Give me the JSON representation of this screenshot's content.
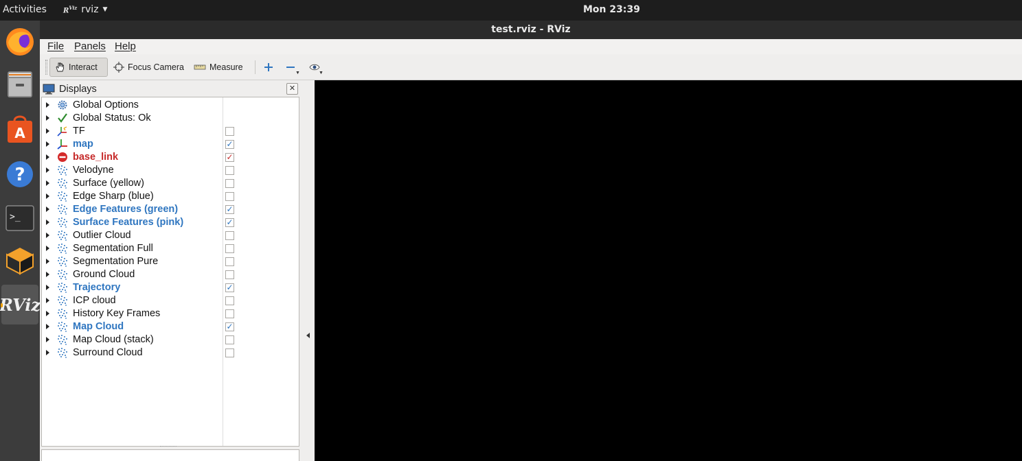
{
  "topbar": {
    "activities": "Activities",
    "app_name": "rviz",
    "app_glyph": "RViz",
    "clock": "Mon 23:39"
  },
  "dock": {
    "items": [
      {
        "name": "firefox-icon"
      },
      {
        "name": "files-icon"
      },
      {
        "name": "software-center-icon"
      },
      {
        "name": "help-icon"
      },
      {
        "name": "terminal-icon"
      },
      {
        "name": "box-icon"
      },
      {
        "name": "rviz-icon",
        "label": "RViz",
        "active": true
      }
    ]
  },
  "window": {
    "title": "test.rviz - RViz"
  },
  "menu": {
    "file": "File",
    "panels": "Panels",
    "help": "Help"
  },
  "toolbar": {
    "interact": "Interact",
    "focus_camera": "Focus Camera",
    "measure": "Measure"
  },
  "displays": {
    "title": "Displays",
    "close_glyph": "✕",
    "rows": [
      {
        "label": "Global Options",
        "icon": "gear-icon",
        "style": "normal",
        "checkbox": "none"
      },
      {
        "label": "Global Status: Ok",
        "icon": "checkmark-icon",
        "style": "normal",
        "checkbox": "none"
      },
      {
        "label": "TF",
        "icon": "tf-axes-icon",
        "style": "normal",
        "checkbox": "unchecked"
      },
      {
        "label": "map",
        "icon": "axes-icon",
        "style": "blue",
        "checkbox": "checked"
      },
      {
        "label": "base_link",
        "icon": "error-icon",
        "style": "red",
        "checkbox": "checked-red"
      },
      {
        "label": "Velodyne",
        "icon": "pointcloud-icon",
        "style": "normal",
        "checkbox": "unchecked"
      },
      {
        "label": "Surface (yellow)",
        "icon": "pointcloud-icon",
        "style": "normal",
        "checkbox": "unchecked"
      },
      {
        "label": "Edge Sharp (blue)",
        "icon": "pointcloud-icon",
        "style": "normal",
        "checkbox": "unchecked"
      },
      {
        "label": "Edge Features (green)",
        "icon": "pointcloud-icon",
        "style": "blue",
        "checkbox": "checked"
      },
      {
        "label": "Surface Features (pink)",
        "icon": "pointcloud-icon",
        "style": "blue",
        "checkbox": "checked"
      },
      {
        "label": "Outlier Cloud",
        "icon": "pointcloud-icon",
        "style": "normal",
        "checkbox": "unchecked"
      },
      {
        "label": "Segmentation Full",
        "icon": "pointcloud-icon",
        "style": "normal",
        "checkbox": "unchecked"
      },
      {
        "label": "Segmentation Pure",
        "icon": "pointcloud-icon",
        "style": "normal",
        "checkbox": "unchecked"
      },
      {
        "label": "Ground Cloud",
        "icon": "pointcloud-icon",
        "style": "normal",
        "checkbox": "unchecked"
      },
      {
        "label": "Trajectory",
        "icon": "pointcloud-icon",
        "style": "blue",
        "checkbox": "checked"
      },
      {
        "label": "ICP cloud",
        "icon": "pointcloud-icon",
        "style": "normal",
        "checkbox": "unchecked"
      },
      {
        "label": "History Key Frames",
        "icon": "pointcloud-icon",
        "style": "normal",
        "checkbox": "unchecked"
      },
      {
        "label": "Map Cloud",
        "icon": "pointcloud-icon",
        "style": "blue",
        "checkbox": "checked"
      },
      {
        "label": "Map Cloud (stack)",
        "icon": "pointcloud-icon",
        "style": "normal",
        "checkbox": "unchecked"
      },
      {
        "label": "Surround Cloud",
        "icon": "pointcloud-icon",
        "style": "normal",
        "checkbox": "unchecked"
      }
    ]
  },
  "colors": {
    "enabled_blue": "#2f76c0",
    "error_red": "#c62a2a",
    "viewport_bg": "#000000"
  }
}
